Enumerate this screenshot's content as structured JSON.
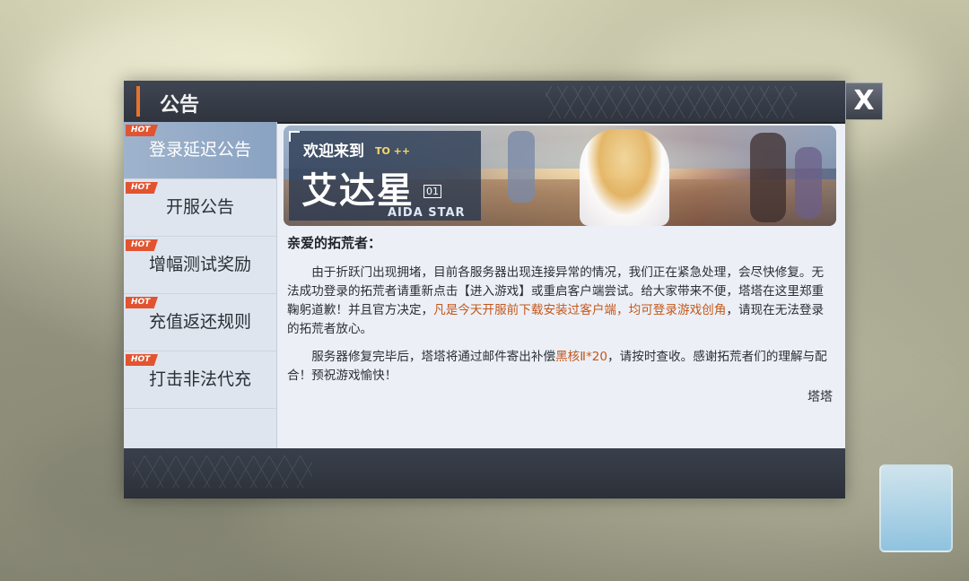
{
  "dialog": {
    "title": "公告",
    "close_label": "X"
  },
  "sidebar": {
    "items": [
      {
        "badge": "HOT",
        "label": "登录延迟公告",
        "active": true
      },
      {
        "badge": "HOT",
        "label": "开服公告",
        "active": false
      },
      {
        "badge": "HOT",
        "label": "增幅测试奖励",
        "active": false
      },
      {
        "badge": "HOT",
        "label": "充值返还规则",
        "active": false
      },
      {
        "badge": "HOT",
        "label": "打击非法代充",
        "active": false
      }
    ]
  },
  "banner": {
    "welcome": "欢迎来到",
    "to": "TO ++",
    "name": "艾达星",
    "number": "01",
    "english": "AIDA STAR"
  },
  "article": {
    "greeting": "亲爱的拓荒者：",
    "p1_a": "由于折跃门出现拥堵，目前各服务器出现连接异常的情况，我们正在紧急处理，会尽快修复。无法成功登录的拓荒者请重新点击【进入游戏】或重启客户端尝试。给大家带来不便，塔塔在这里郑重鞠躬道歉！并且官方决定，",
    "p1_highlight": "凡是今天开服前下载安装过客户端，均可登录游戏创角",
    "p1_b": "，请现在无法登录的拓荒者放心。",
    "p2_a": "服务器修复完毕后，塔塔将通过邮件寄出补偿",
    "p2_highlight": "黑核Ⅱ*20",
    "p2_b": "，请按时查收。感谢拓荒者们的理解与配合！预祝游戏愉快！",
    "signature": "塔塔"
  },
  "colors": {
    "accent": "#e8732c",
    "highlight": "#c4571c",
    "hot_badge": "#e2542f",
    "active_tab": "#8aa3c2"
  }
}
